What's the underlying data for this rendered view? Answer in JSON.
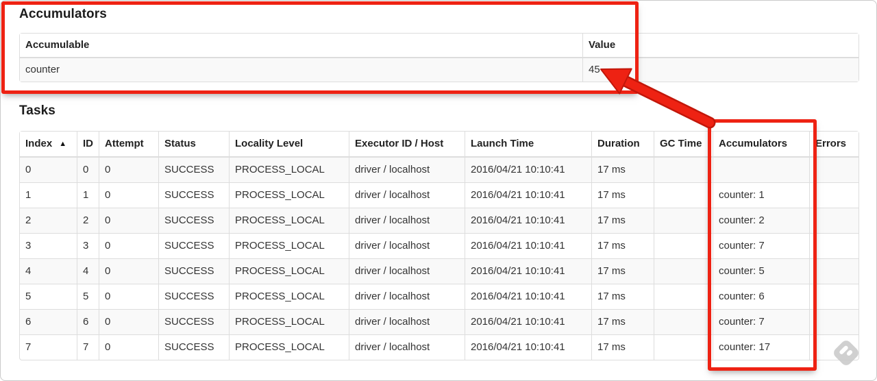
{
  "accumulators_section": {
    "title": "Accumulators",
    "table": {
      "headers": [
        "Accumulable",
        "Value"
      ],
      "rows": [
        [
          "counter",
          "45"
        ]
      ]
    }
  },
  "tasks_section": {
    "title": "Tasks",
    "table": {
      "headers": [
        "Index",
        "ID",
        "Attempt",
        "Status",
        "Locality Level",
        "Executor ID / Host",
        "Launch Time",
        "Duration",
        "GC Time",
        "Accumulators",
        "Errors"
      ],
      "sort": {
        "column_index": 0,
        "indicator": "▲",
        "direction": "ascending"
      },
      "rows": [
        [
          "0",
          "0",
          "0",
          "SUCCESS",
          "PROCESS_LOCAL",
          "driver / localhost",
          "2016/04/21 10:10:41",
          "17 ms",
          "",
          "",
          ""
        ],
        [
          "1",
          "1",
          "0",
          "SUCCESS",
          "PROCESS_LOCAL",
          "driver / localhost",
          "2016/04/21 10:10:41",
          "17 ms",
          "",
          "counter: 1",
          ""
        ],
        [
          "2",
          "2",
          "0",
          "SUCCESS",
          "PROCESS_LOCAL",
          "driver / localhost",
          "2016/04/21 10:10:41",
          "17 ms",
          "",
          "counter: 2",
          ""
        ],
        [
          "3",
          "3",
          "0",
          "SUCCESS",
          "PROCESS_LOCAL",
          "driver / localhost",
          "2016/04/21 10:10:41",
          "17 ms",
          "",
          "counter: 7",
          ""
        ],
        [
          "4",
          "4",
          "0",
          "SUCCESS",
          "PROCESS_LOCAL",
          "driver / localhost",
          "2016/04/21 10:10:41",
          "17 ms",
          "",
          "counter: 5",
          ""
        ],
        [
          "5",
          "5",
          "0",
          "SUCCESS",
          "PROCESS_LOCAL",
          "driver / localhost",
          "2016/04/21 10:10:41",
          "17 ms",
          "",
          "counter: 6",
          ""
        ],
        [
          "6",
          "6",
          "0",
          "SUCCESS",
          "PROCESS_LOCAL",
          "driver / localhost",
          "2016/04/21 10:10:41",
          "17 ms",
          "",
          "counter: 7",
          ""
        ],
        [
          "7",
          "7",
          "0",
          "SUCCESS",
          "PROCESS_LOCAL",
          "driver / localhost",
          "2016/04/21 10:10:41",
          "17 ms",
          "",
          "counter: 17",
          ""
        ]
      ]
    }
  },
  "annotations": {
    "highlight_color": "#ee2213",
    "highlight_outline_color": "#c2170a",
    "boxed_regions": [
      "accumulators-summary-table",
      "tasks-accumulators-column"
    ],
    "arrow_points_to_value": "45"
  },
  "watermark": {
    "name": "feedly-logo",
    "color": "#cbcbcb"
  }
}
